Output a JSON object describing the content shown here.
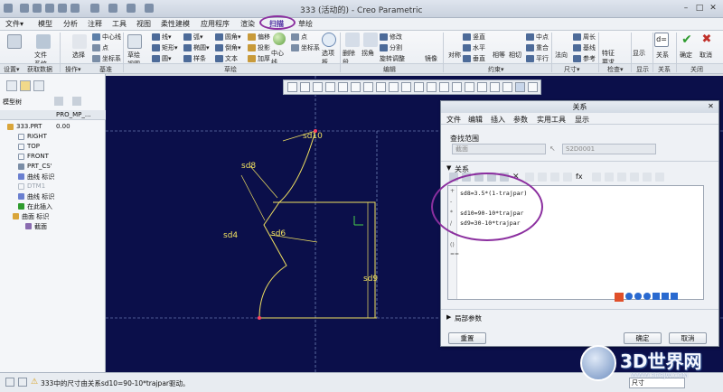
{
  "window": {
    "title": "333 (活动的) - Creo Parametric"
  },
  "menubar": {
    "items": [
      "文件▾",
      "模型",
      "分析",
      "注释",
      "工具",
      "视图",
      "柔性建模",
      "应用程序",
      "渲染",
      "扫描",
      "草绘"
    ]
  },
  "ribbon": {
    "groups": [
      "设置▾",
      "获取数据",
      "操作▾",
      "基准",
      "草绘",
      "编辑",
      "约束▾",
      "尺寸▾",
      "检查▾",
      "显示",
      "关系",
      "关闭"
    ],
    "buttons": {
      "file_system": "文件系统",
      "select": "选择",
      "centerline": "中心线",
      "point": "点",
      "coordsys": "坐标系",
      "sketch_view": "草绘视图",
      "line": "线",
      "rect": "矩形",
      "circle": "圆",
      "arc": "弧",
      "ellipse": "椭圆",
      "spline": "样条",
      "fillet": "圆角",
      "chamfer": "倒角",
      "text": "文本",
      "offset": "偏移",
      "project": "投影",
      "thicken": "加厚",
      "center_line": "中心线",
      "point2": "点",
      "coordsys2": "坐标系",
      "palette": "选项板",
      "delete_seg": "删除段",
      "corner": "拐角",
      "modify": "修改",
      "divide": "分割",
      "rotate_resize": "旋转调整大小",
      "mirror": "镜像",
      "vertical": "竖直",
      "horizontal": "水平",
      "perpendicular": "垂直",
      "tangent": "相切",
      "midpoint": "中点",
      "coincident": "重合",
      "symmetric": "对称",
      "equal": "相等",
      "parallel": "平行",
      "normal": "法向",
      "perimeter": "周长",
      "baseline": "基线",
      "reference": "参考",
      "feature_req": "特征要求",
      "display": "显示",
      "relation": "关系",
      "ok": "确定",
      "cancel": "取消"
    }
  },
  "leftpanel": {
    "tree_title": "模型树",
    "col_header": "PRO_MP_...",
    "items": [
      {
        "label": "333.PRT",
        "value": "0.00"
      },
      {
        "label": "RIGHT",
        "value": ""
      },
      {
        "label": "TOP",
        "value": ""
      },
      {
        "label": "FRONT",
        "value": ""
      },
      {
        "label": "PRT_CS'",
        "value": ""
      },
      {
        "label": "曲线 标识",
        "value": ""
      },
      {
        "label": "DTM1",
        "value": ""
      },
      {
        "label": "曲线 标识",
        "value": ""
      },
      {
        "label": "在此插入",
        "value": ""
      },
      {
        "label": "曲面 标识",
        "value": ""
      },
      {
        "label": "截面",
        "value": ""
      }
    ]
  },
  "sketch": {
    "dims": [
      "sd10",
      "sd8",
      "sd4",
      "sd6",
      "sd9"
    ]
  },
  "dialog": {
    "title": "关系",
    "menu": [
      "文件",
      "编辑",
      "插入",
      "参数",
      "实用工具",
      "显示"
    ],
    "lookup_label": "查找范围",
    "lookup_type": "截面",
    "lookup_value": "S2D0001",
    "relations_label": "关系",
    "lines": [
      "sd8=3.5*(1-trajpar)",
      "",
      "sd10=90-10*trajpar",
      "sd9=30-10*trajpar"
    ],
    "local_params": "局部参数",
    "reset": "重置",
    "ok": "确定",
    "cancel": "取消"
  },
  "statusbar": {
    "message": "333中的尺寸由关系sd10=90-10*trajpar驱动。",
    "filter": "尺寸"
  },
  "watermark": {
    "brand": "3D世界网",
    "url": "WWW.3DSJW.COM"
  }
}
